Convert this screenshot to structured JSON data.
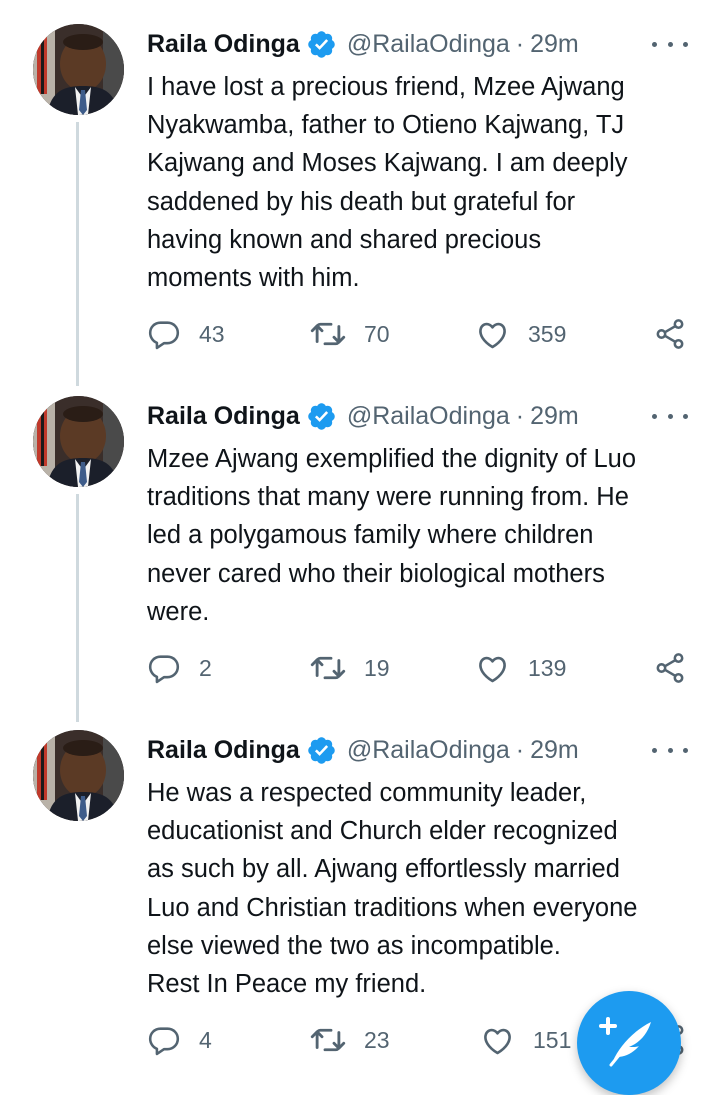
{
  "author": {
    "name": "Raila Odinga",
    "handle": "@RailaOdinga",
    "verified": true,
    "avatar": "author-avatar"
  },
  "colors": {
    "verified_badge": "#1d9bf0",
    "secondary_text": "#536471",
    "thread_line": "#cfd9de",
    "fab": "#1d9bf0"
  },
  "tweets": [
    {
      "time": "29m",
      "text": "I have lost a precious friend, Mzee Ajwang\nNyakwamba, father to Otieno Kajwang, TJ\nKajwang and Moses Kajwang. I am deeply\nsaddened by his death but grateful for\nhaving known and shared precious\nmoments with him.",
      "replies": "43",
      "retweets": "70",
      "likes": "359"
    },
    {
      "time": "29m",
      "text": "Mzee Ajwang exemplified the dignity of Luo\ntraditions that many were running from. He\nled a polygamous family where children\nnever cared who their biological mothers\nwere.",
      "replies": "2",
      "retweets": "19",
      "likes": "139"
    },
    {
      "time": "29m",
      "text": "He was a respected community leader,\neducationist and Church elder recognized\nas such by all. Ajwang effortlessly married\nLuo and Christian traditions when everyone\nelse viewed the two as incompatible.\nRest In Peace my friend.",
      "replies": "4",
      "retweets": "23",
      "likes": "151"
    }
  ],
  "icons": {
    "reply": "reply-icon",
    "retweet": "retweet-icon",
    "like": "heart-icon",
    "share": "share-icon",
    "more": "more-icon",
    "verified": "verified-badge-icon",
    "compose": "compose-tweet-icon"
  },
  "sep": "·"
}
